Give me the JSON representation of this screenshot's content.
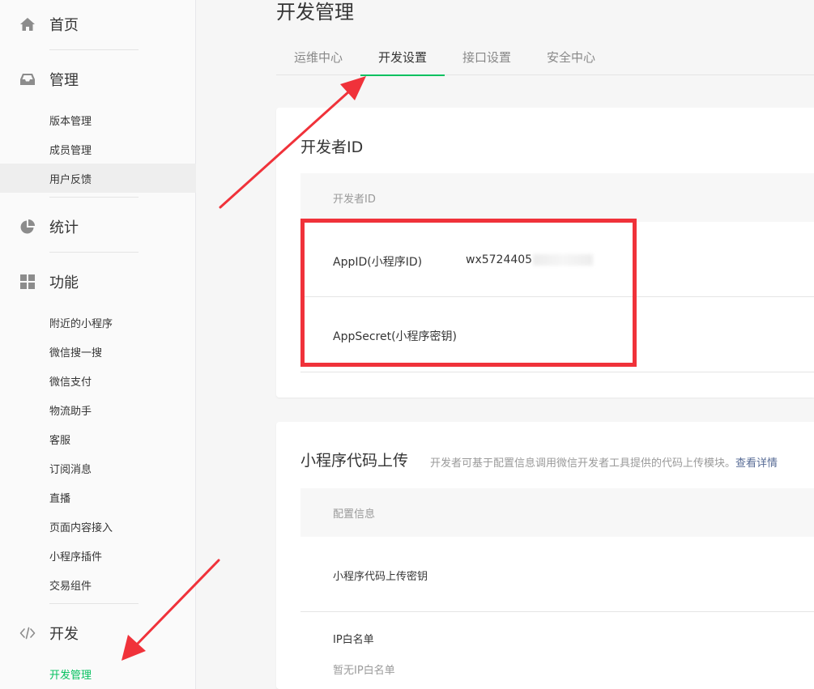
{
  "sidebar": {
    "home": {
      "label": "首页",
      "icon": "home-icon"
    },
    "manage": {
      "label": "管理",
      "icon": "inbox-icon",
      "items": [
        "版本管理",
        "成员管理",
        "用户反馈"
      ]
    },
    "stats": {
      "label": "统计",
      "icon": "pie-chart-icon"
    },
    "features": {
      "label": "功能",
      "icon": "grid-icon",
      "items": [
        "附近的小程序",
        "微信搜一搜",
        "微信支付",
        "物流助手",
        "客服",
        "订阅消息",
        "直播",
        "页面内容接入",
        "小程序插件",
        "交易组件"
      ]
    },
    "dev": {
      "label": "开发",
      "icon": "code-icon",
      "items": [
        "开发管理"
      ]
    }
  },
  "main": {
    "title": "开发管理",
    "tabs": [
      {
        "label": "运维中心"
      },
      {
        "label": "开发设置",
        "active": true
      },
      {
        "label": "接口设置"
      },
      {
        "label": "安全中心"
      }
    ],
    "dev_id_card": {
      "title": "开发者ID",
      "header": "开发者ID",
      "rows": [
        {
          "key": "AppID(小程序ID)",
          "value": "wx5724405"
        },
        {
          "key": "AppSecret(小程序密钥)",
          "value": ""
        }
      ]
    },
    "upload_card": {
      "title": "小程序代码上传",
      "desc": "开发者可基于配置信息调用微信开发者工具提供的代码上传模块。",
      "link": "查看详情",
      "header": "配置信息",
      "rows": [
        {
          "key": "小程序代码上传密钥"
        },
        {
          "key": "IP白名单",
          "sub": "暂无IP白名单"
        }
      ]
    }
  },
  "colors": {
    "accent": "#07c160",
    "annotation": "#f0323a",
    "link": "#576b95"
  }
}
